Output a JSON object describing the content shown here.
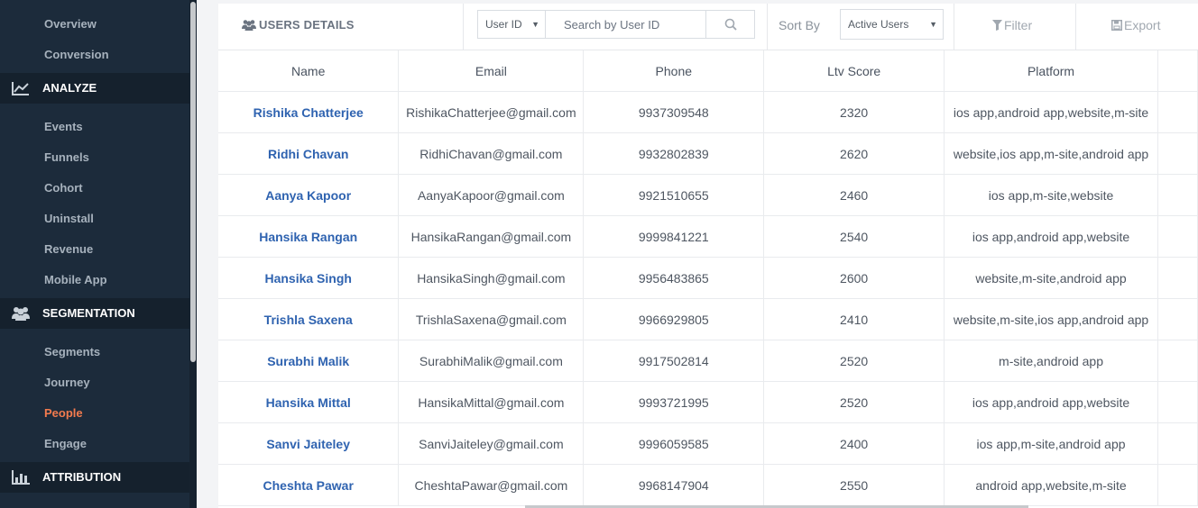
{
  "sidebar": {
    "items": [
      {
        "label": "Overview"
      },
      {
        "label": "Conversion"
      },
      {
        "label": "ANALYZE",
        "icon": "line-chart-icon"
      },
      {
        "label": "Events"
      },
      {
        "label": "Funnels"
      },
      {
        "label": "Cohort"
      },
      {
        "label": "Uninstall"
      },
      {
        "label": "Revenue"
      },
      {
        "label": "Mobile App"
      },
      {
        "label": "SEGMENTATION",
        "icon": "users-icon"
      },
      {
        "label": "Segments"
      },
      {
        "label": "Journey"
      },
      {
        "label": "People",
        "active": true
      },
      {
        "label": "Engage"
      },
      {
        "label": "ATTRIBUTION",
        "icon": "bar-chart-icon"
      }
    ],
    "active_color": "#f37b4e"
  },
  "toolbar": {
    "title": "USERS DETAILS",
    "title_icon": "users-icon",
    "search_field_select": "User ID",
    "search_placeholder": "Search by User ID",
    "search_icon": "search-icon",
    "sort_label": "Sort By",
    "sort_value": "Active Users",
    "filter_label": "Filter",
    "filter_icon": "filter-icon",
    "export_label": "Export",
    "export_icon": "save-icon"
  },
  "table": {
    "columns": [
      "Name",
      "Email",
      "Phone",
      "Ltv Score",
      "Platform"
    ],
    "rows": [
      [
        "Rishika Chatterjee",
        "RishikaChatterjee@gmail.com",
        "9937309548",
        "2320",
        "ios app,android app,website,m-site"
      ],
      [
        "Ridhi Chavan",
        "RidhiChavan@gmail.com",
        "9932802839",
        "2620",
        "website,ios app,m-site,android app"
      ],
      [
        "Aanya Kapoor",
        "AanyaKapoor@gmail.com",
        "9921510655",
        "2460",
        "ios app,m-site,website"
      ],
      [
        "Hansika Rangan",
        "HansikaRangan@gmail.com",
        "9999841221",
        "2540",
        "ios app,android app,website"
      ],
      [
        "Hansika Singh",
        "HansikaSingh@gmail.com",
        "9956483865",
        "2600",
        "website,m-site,android app"
      ],
      [
        "Trishla Saxena",
        "TrishlaSaxena@gmail.com",
        "9966929805",
        "2410",
        "website,m-site,ios app,android app"
      ],
      [
        "Surabhi Malik",
        "SurabhiMalik@gmail.com",
        "9917502814",
        "2520",
        "m-site,android app"
      ],
      [
        "Hansika Mittal",
        "HansikaMittal@gmail.com",
        "9993721995",
        "2520",
        "ios app,android app,website"
      ],
      [
        "Sanvi Jaiteley",
        "SanviJaiteley@gmail.com",
        "9996059585",
        "2400",
        "ios app,m-site,android app"
      ],
      [
        "Cheshta Pawar",
        "CheshtaPawar@gmail.com",
        "9968147904",
        "2550",
        "android app,website,m-site"
      ]
    ],
    "name_color": "#2f63b0"
  }
}
